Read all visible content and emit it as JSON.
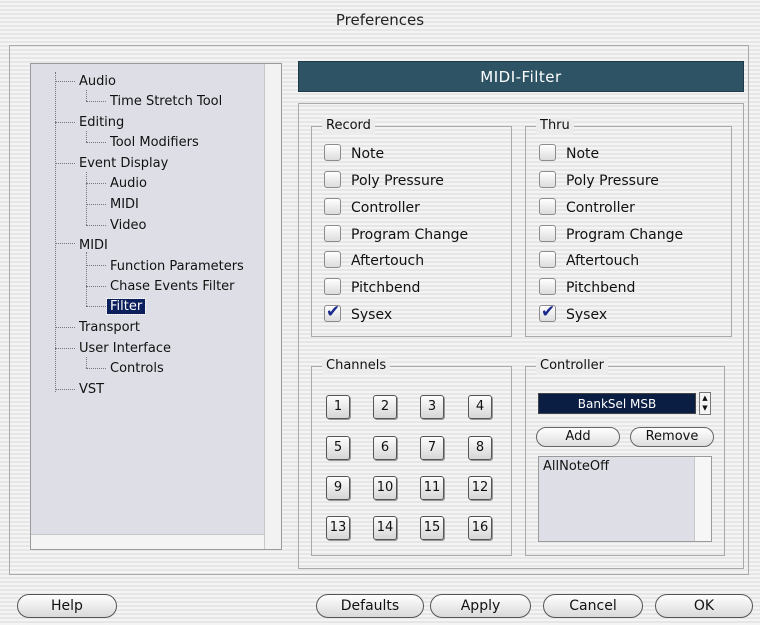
{
  "window": {
    "title": "Preferences"
  },
  "tree": {
    "items": [
      {
        "label": "Audio"
      },
      {
        "label": "Time Stretch Tool"
      },
      {
        "label": "Editing"
      },
      {
        "label": "Tool Modifiers"
      },
      {
        "label": "Event Display"
      },
      {
        "label": "Audio"
      },
      {
        "label": "MIDI"
      },
      {
        "label": "Video"
      },
      {
        "label": "MIDI"
      },
      {
        "label": "Function Parameters"
      },
      {
        "label": "Chase Events Filter"
      },
      {
        "label": "Filter"
      },
      {
        "label": "Transport"
      },
      {
        "label": "User Interface"
      },
      {
        "label": "Controls"
      },
      {
        "label": "VST"
      }
    ],
    "selected": "Filter"
  },
  "panel": {
    "title": "MIDI-Filter",
    "record": {
      "title": "Record",
      "items": [
        {
          "label": "Note",
          "checked": false
        },
        {
          "label": "Poly Pressure",
          "checked": false
        },
        {
          "label": "Controller",
          "checked": false
        },
        {
          "label": "Program Change",
          "checked": false
        },
        {
          "label": "Aftertouch",
          "checked": false
        },
        {
          "label": "Pitchbend",
          "checked": false
        },
        {
          "label": "Sysex",
          "checked": true
        }
      ]
    },
    "thru": {
      "title": "Thru",
      "items": [
        {
          "label": "Note",
          "checked": false
        },
        {
          "label": "Poly Pressure",
          "checked": false
        },
        {
          "label": "Controller",
          "checked": false
        },
        {
          "label": "Program Change",
          "checked": false
        },
        {
          "label": "Aftertouch",
          "checked": false
        },
        {
          "label": "Pitchbend",
          "checked": false
        },
        {
          "label": "Sysex",
          "checked": true
        }
      ]
    },
    "channels": {
      "title": "Channels",
      "buttons": [
        "1",
        "2",
        "3",
        "4",
        "5",
        "6",
        "7",
        "8",
        "9",
        "10",
        "11",
        "12",
        "13",
        "14",
        "15",
        "16"
      ]
    },
    "controller": {
      "title": "Controller",
      "selected": "BankSel MSB",
      "add_label": "Add",
      "remove_label": "Remove",
      "list": [
        "AllNoteOff"
      ]
    }
  },
  "footer": {
    "help": "Help",
    "defaults": "Defaults",
    "apply": "Apply",
    "cancel": "Cancel",
    "ok": "OK"
  },
  "colors": {
    "header_bg": "#2e5364",
    "selection_bg": "#0a1f5c",
    "select_bg": "#0a1d43",
    "check_color": "#1a2a8c"
  }
}
